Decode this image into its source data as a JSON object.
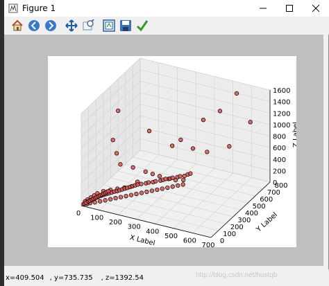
{
  "window": {
    "title": "Figure 1"
  },
  "toolbar": {
    "tools": [
      {
        "name": "home-icon"
      },
      {
        "name": "back-icon"
      },
      {
        "name": "forward-icon"
      },
      {
        "name": "pan-icon"
      },
      {
        "name": "zoom-icon"
      },
      {
        "name": "subplots-icon"
      },
      {
        "name": "save-icon"
      },
      {
        "name": "edit-icon"
      }
    ]
  },
  "status": {
    "x": "x=409.504",
    "y": ", y=735.735",
    "z": ", z=1392.54"
  },
  "watermark": "http://blog.csdn.net/hustqb",
  "colors": {
    "marker_fill": "#d9534f",
    "marker_edge": "#000000",
    "pane": "#f2f2f2"
  },
  "chart_data": {
    "type": "scatter",
    "projection": "3d",
    "xlabel": "X Label",
    "ylabel": "Y Label",
    "zlabel": "Z Label",
    "xlim": [
      0,
      700
    ],
    "ylim": [
      0,
      800
    ],
    "zlim": [
      0,
      1600
    ],
    "x_ticks": [
      "0",
      "100",
      "200",
      "300",
      "400",
      "500",
      "600",
      "700"
    ],
    "y_ticks": [
      "0",
      "100",
      "200",
      "300",
      "400",
      "500",
      "600",
      "700",
      "800"
    ],
    "z_ticks": [
      "0",
      "200",
      "400",
      "600",
      "800",
      "1000",
      "1200",
      "1400",
      "1600"
    ],
    "grid": true,
    "points": [
      {
        "x": 40,
        "y": 400,
        "z": 1200
      },
      {
        "x": 560,
        "y": 700,
        "z": 1550
      },
      {
        "x": 610,
        "y": 760,
        "z": 1020
      },
      {
        "x": 420,
        "y": 600,
        "z": 1100
      },
      {
        "x": 490,
        "y": 650,
        "z": 1250
      },
      {
        "x": 200,
        "y": 420,
        "z": 950
      },
      {
        "x": 330,
        "y": 520,
        "z": 780
      },
      {
        "x": 300,
        "y": 480,
        "z": 700
      },
      {
        "x": 380,
        "y": 560,
        "z": 620
      },
      {
        "x": 520,
        "y": 700,
        "z": 600
      },
      {
        "x": 440,
        "y": 600,
        "z": 560
      },
      {
        "x": 20,
        "y": 380,
        "z": 700
      },
      {
        "x": 60,
        "y": 330,
        "z": 560
      },
      {
        "x": 100,
        "y": 280,
        "z": 460
      },
      {
        "x": 160,
        "y": 300,
        "z": 430
      },
      {
        "x": 220,
        "y": 320,
        "z": 380
      },
      {
        "x": 250,
        "y": 340,
        "z": 340
      },
      {
        "x": 280,
        "y": 360,
        "z": 300
      },
      {
        "x": 320,
        "y": 380,
        "z": 260
      },
      {
        "x": 350,
        "y": 400,
        "z": 240
      },
      {
        "x": 380,
        "y": 430,
        "z": 230
      },
      {
        "x": 200,
        "y": 260,
        "z": 260
      },
      {
        "x": 180,
        "y": 230,
        "z": 200
      },
      {
        "x": 150,
        "y": 210,
        "z": 180
      },
      {
        "x": 120,
        "y": 190,
        "z": 160
      },
      {
        "x": 90,
        "y": 170,
        "z": 140
      },
      {
        "x": 60,
        "y": 150,
        "z": 120
      },
      {
        "x": 40,
        "y": 120,
        "z": 100
      },
      {
        "x": 30,
        "y": 100,
        "z": 80
      },
      {
        "x": 20,
        "y": 80,
        "z": 60
      },
      {
        "x": 10,
        "y": 60,
        "z": 40
      },
      {
        "x": 5,
        "y": 40,
        "z": 30
      },
      {
        "x": 15,
        "y": 50,
        "z": 20
      },
      {
        "x": 25,
        "y": 70,
        "z": 30
      },
      {
        "x": 35,
        "y": 90,
        "z": 40
      },
      {
        "x": 45,
        "y": 110,
        "z": 50
      },
      {
        "x": 55,
        "y": 130,
        "z": 60
      },
      {
        "x": 65,
        "y": 140,
        "z": 70
      },
      {
        "x": 75,
        "y": 150,
        "z": 80
      },
      {
        "x": 85,
        "y": 160,
        "z": 90
      },
      {
        "x": 95,
        "y": 175,
        "z": 95
      },
      {
        "x": 105,
        "y": 185,
        "z": 105
      },
      {
        "x": 115,
        "y": 195,
        "z": 110
      },
      {
        "x": 125,
        "y": 205,
        "z": 120
      },
      {
        "x": 135,
        "y": 215,
        "z": 130
      },
      {
        "x": 145,
        "y": 225,
        "z": 140
      },
      {
        "x": 155,
        "y": 235,
        "z": 150
      },
      {
        "x": 165,
        "y": 245,
        "z": 160
      },
      {
        "x": 175,
        "y": 255,
        "z": 170
      },
      {
        "x": 185,
        "y": 265,
        "z": 180
      },
      {
        "x": 195,
        "y": 275,
        "z": 190
      },
      {
        "x": 210,
        "y": 285,
        "z": 200
      },
      {
        "x": 230,
        "y": 300,
        "z": 210
      },
      {
        "x": 240,
        "y": 310,
        "z": 220
      },
      {
        "x": 260,
        "y": 320,
        "z": 230
      },
      {
        "x": 270,
        "y": 330,
        "z": 240
      },
      {
        "x": 290,
        "y": 345,
        "z": 250
      },
      {
        "x": 300,
        "y": 355,
        "z": 260
      },
      {
        "x": 310,
        "y": 365,
        "z": 270
      },
      {
        "x": 330,
        "y": 375,
        "z": 280
      },
      {
        "x": 340,
        "y": 385,
        "z": 290
      },
      {
        "x": 360,
        "y": 400,
        "z": 300
      },
      {
        "x": 370,
        "y": 410,
        "z": 310
      },
      {
        "x": 390,
        "y": 420,
        "z": 320
      },
      {
        "x": 400,
        "y": 440,
        "z": 330
      },
      {
        "x": 410,
        "y": 450,
        "z": 340
      },
      {
        "x": 20,
        "y": 30,
        "z": 10
      },
      {
        "x": 30,
        "y": 45,
        "z": 15
      },
      {
        "x": 50,
        "y": 60,
        "z": 25
      },
      {
        "x": 70,
        "y": 80,
        "z": 35
      },
      {
        "x": 90,
        "y": 100,
        "z": 45
      },
      {
        "x": 110,
        "y": 120,
        "z": 55
      },
      {
        "x": 130,
        "y": 140,
        "z": 65
      },
      {
        "x": 150,
        "y": 160,
        "z": 75
      },
      {
        "x": 170,
        "y": 180,
        "z": 85
      },
      {
        "x": 190,
        "y": 200,
        "z": 95
      },
      {
        "x": 210,
        "y": 220,
        "z": 105
      },
      {
        "x": 230,
        "y": 240,
        "z": 115
      },
      {
        "x": 250,
        "y": 260,
        "z": 125
      },
      {
        "x": 270,
        "y": 280,
        "z": 135
      },
      {
        "x": 290,
        "y": 300,
        "z": 145
      },
      {
        "x": 310,
        "y": 320,
        "z": 155
      },
      {
        "x": 330,
        "y": 340,
        "z": 165
      },
      {
        "x": 350,
        "y": 360,
        "z": 175
      },
      {
        "x": 370,
        "y": 380,
        "z": 185
      },
      {
        "x": 390,
        "y": 400,
        "z": 195
      },
      {
        "x": 5,
        "y": 20,
        "z": 5
      },
      {
        "x": 8,
        "y": 25,
        "z": 12
      },
      {
        "x": 12,
        "y": 35,
        "z": 18
      },
      {
        "x": 18,
        "y": 55,
        "z": 22
      },
      {
        "x": 22,
        "y": 65,
        "z": 28
      },
      {
        "x": 28,
        "y": 75,
        "z": 35
      },
      {
        "x": 32,
        "y": 85,
        "z": 42
      },
      {
        "x": 38,
        "y": 95,
        "z": 48
      },
      {
        "x": 42,
        "y": 105,
        "z": 55
      },
      {
        "x": 48,
        "y": 115,
        "z": 62
      },
      {
        "x": 52,
        "y": 125,
        "z": 68
      },
      {
        "x": 58,
        "y": 135,
        "z": 75
      },
      {
        "x": 62,
        "y": 145,
        "z": 82
      },
      {
        "x": 68,
        "y": 155,
        "z": 88
      },
      {
        "x": 72,
        "y": 165,
        "z": 95
      },
      {
        "x": 78,
        "y": 175,
        "z": 102
      }
    ]
  }
}
